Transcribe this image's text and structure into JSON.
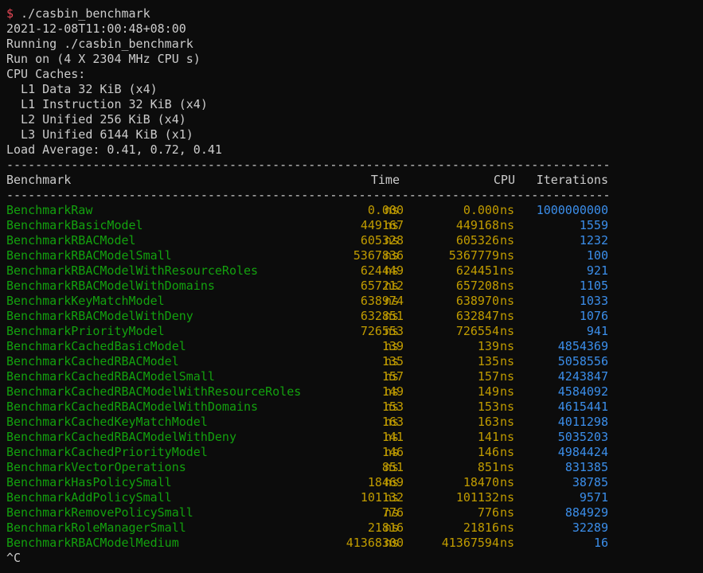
{
  "colors": {
    "background": "#0c0c0c",
    "text": "#cccccc",
    "prompt": "#e74856",
    "name": "#13a10e",
    "value": "#c19c00",
    "iterations": "#3b8eea"
  },
  "prompt": {
    "symbol": "$",
    "command": " ./casbin_benchmark"
  },
  "preamble": [
    "2021-12-08T11:00:48+08:00",
    "Running ./casbin_benchmark",
    "Run on (4 X 2304 MHz CPU s)",
    "CPU Caches:",
    "  L1 Data 32 KiB (x4)",
    "  L1 Instruction 32 KiB (x4)",
    "  L2 Unified 256 KiB (x4)",
    "  L3 Unified 6144 KiB (x1)",
    "Load Average: 0.41, 0.72, 0.41"
  ],
  "separator": "------------------------------------------------------------------------------------------------------------------------",
  "headers": {
    "benchmark": "Benchmark",
    "time": "Time",
    "cpu": "CPU",
    "iterations": "Iterations"
  },
  "rows": [
    {
      "name": "BenchmarkRaw",
      "time": "0.000",
      "time_unit": "ns",
      "cpu": "0.000",
      "cpu_unit": "ns",
      "iterations": "1000000000"
    },
    {
      "name": "BenchmarkBasicModel",
      "time": "449167",
      "time_unit": "ns",
      "cpu": "449168",
      "cpu_unit": "ns",
      "iterations": "1559"
    },
    {
      "name": "BenchmarkRBACModel",
      "time": "605328",
      "time_unit": "ns",
      "cpu": "605326",
      "cpu_unit": "ns",
      "iterations": "1232"
    },
    {
      "name": "BenchmarkRBACModelSmall",
      "time": "5367836",
      "time_unit": "ns",
      "cpu": "5367779",
      "cpu_unit": "ns",
      "iterations": "100"
    },
    {
      "name": "BenchmarkRBACModelWithResourceRoles",
      "time": "624449",
      "time_unit": "ns",
      "cpu": "624451",
      "cpu_unit": "ns",
      "iterations": "921"
    },
    {
      "name": "BenchmarkRBACModelWithDomains",
      "time": "657212",
      "time_unit": "ns",
      "cpu": "657208",
      "cpu_unit": "ns",
      "iterations": "1105"
    },
    {
      "name": "BenchmarkKeyMatchModel",
      "time": "638974",
      "time_unit": "ns",
      "cpu": "638970",
      "cpu_unit": "ns",
      "iterations": "1033"
    },
    {
      "name": "BenchmarkRBACModelWithDeny",
      "time": "632851",
      "time_unit": "ns",
      "cpu": "632847",
      "cpu_unit": "ns",
      "iterations": "1076"
    },
    {
      "name": "BenchmarkPriorityModel",
      "time": "726553",
      "time_unit": "ns",
      "cpu": "726554",
      "cpu_unit": "ns",
      "iterations": "941"
    },
    {
      "name": "BenchmarkCachedBasicModel",
      "time": "139",
      "time_unit": "ns",
      "cpu": "139",
      "cpu_unit": "ns",
      "iterations": "4854369"
    },
    {
      "name": "BenchmarkCachedRBACModel",
      "time": "135",
      "time_unit": "ns",
      "cpu": "135",
      "cpu_unit": "ns",
      "iterations": "5058556"
    },
    {
      "name": "BenchmarkCachedRBACModelSmall",
      "time": "157",
      "time_unit": "ns",
      "cpu": "157",
      "cpu_unit": "ns",
      "iterations": "4243847"
    },
    {
      "name": "BenchmarkCachedRBACModelWithResourceRoles",
      "time": "149",
      "time_unit": "ns",
      "cpu": "149",
      "cpu_unit": "ns",
      "iterations": "4584092"
    },
    {
      "name": "BenchmarkCachedRBACModelWithDomains",
      "time": "153",
      "time_unit": "ns",
      "cpu": "153",
      "cpu_unit": "ns",
      "iterations": "4615441"
    },
    {
      "name": "BenchmarkCachedKeyMatchModel",
      "time": "163",
      "time_unit": "ns",
      "cpu": "163",
      "cpu_unit": "ns",
      "iterations": "4011298"
    },
    {
      "name": "BenchmarkCachedRBACModelWithDeny",
      "time": "141",
      "time_unit": "ns",
      "cpu": "141",
      "cpu_unit": "ns",
      "iterations": "5035203"
    },
    {
      "name": "BenchmarkCachedPriorityModel",
      "time": "146",
      "time_unit": "ns",
      "cpu": "146",
      "cpu_unit": "ns",
      "iterations": "4984424"
    },
    {
      "name": "BenchmarkVectorOperations",
      "time": "851",
      "time_unit": "ns",
      "cpu": "851",
      "cpu_unit": "ns",
      "iterations": "831385"
    },
    {
      "name": "BenchmarkHasPolicySmall",
      "time": "18469",
      "time_unit": "ns",
      "cpu": "18470",
      "cpu_unit": "ns",
      "iterations": "38785"
    },
    {
      "name": "BenchmarkAddPolicySmall",
      "time": "101132",
      "time_unit": "ns",
      "cpu": "101132",
      "cpu_unit": "ns",
      "iterations": "9571"
    },
    {
      "name": "BenchmarkRemovePolicySmall",
      "time": "776",
      "time_unit": "ns",
      "cpu": "776",
      "cpu_unit": "ns",
      "iterations": "884929"
    },
    {
      "name": "BenchmarkRoleManagerSmall",
      "time": "21816",
      "time_unit": "ns",
      "cpu": "21816",
      "cpu_unit": "ns",
      "iterations": "32289"
    },
    {
      "name": "BenchmarkRBACModelMedium",
      "time": "41368300",
      "time_unit": "ns",
      "cpu": "41367594",
      "cpu_unit": "ns",
      "iterations": "16"
    }
  ],
  "interrupt": "^C"
}
